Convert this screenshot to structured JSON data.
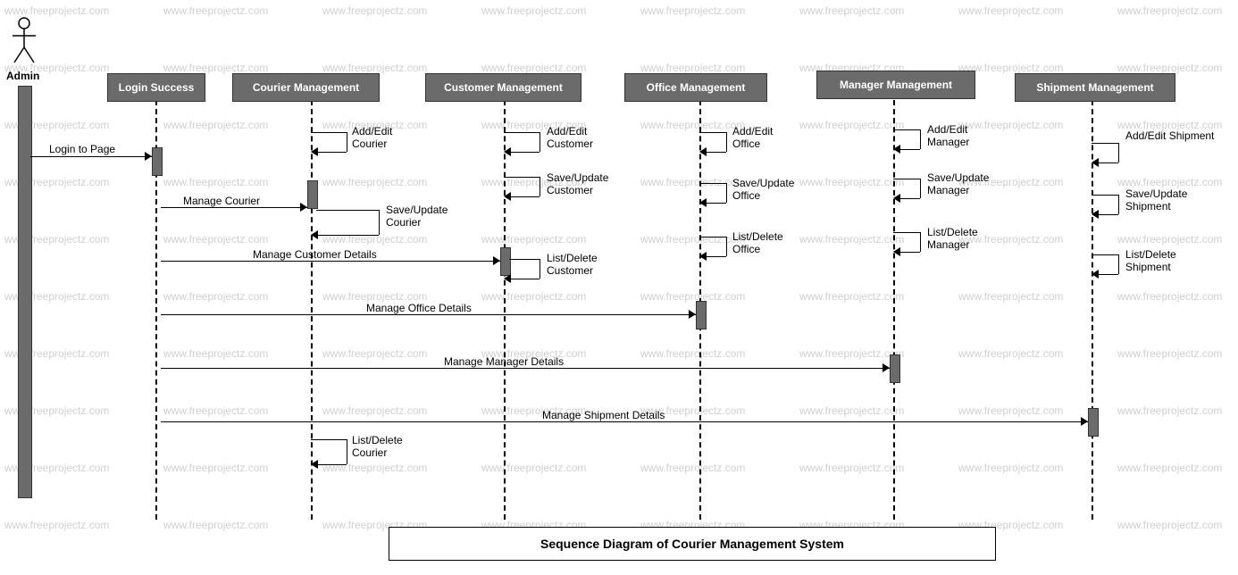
{
  "actor": {
    "name": "Admin"
  },
  "participants": {
    "login": "Login Success",
    "courier": "Courier Management",
    "customer": "Customer Management",
    "office": "Office Management",
    "manager": "Manager Management",
    "shipment": "Shipment Management"
  },
  "messages": {
    "login_to_page": "Login to Page",
    "manage_courier": "Manage Courier",
    "manage_customer": "Manage Customer Details",
    "manage_office": "Manage Office Details",
    "manage_manager": "Manage Manager Details",
    "manage_shipment": "Manage Shipment Details",
    "add_edit_courier": "Add/Edit\nCourier",
    "save_update_courier": "Save/Update\nCourier",
    "list_delete_courier": "List/Delete\nCourier",
    "add_edit_customer": "Add/Edit\nCustomer",
    "save_update_customer": "Save/Update\nCustomer",
    "list_delete_customer": "List/Delete\nCustomer",
    "add_edit_office": "Add/Edit\nOffice",
    "save_update_office": "Save/Update\nOffice",
    "list_delete_office": "List/Delete\nOffice",
    "add_edit_manager": "Add/Edit\nManager",
    "save_update_manager": "Save/Update\nManager",
    "list_delete_manager": "List/Delete\nManager",
    "add_edit_shipment": "Add/Edit Shipment",
    "save_update_shipment": "Save/Update\nShipment",
    "list_delete_shipment": "List/Delete\nShipment"
  },
  "title": "Sequence Diagram of Courier Management System",
  "watermark": "www.freeprojectz.com"
}
